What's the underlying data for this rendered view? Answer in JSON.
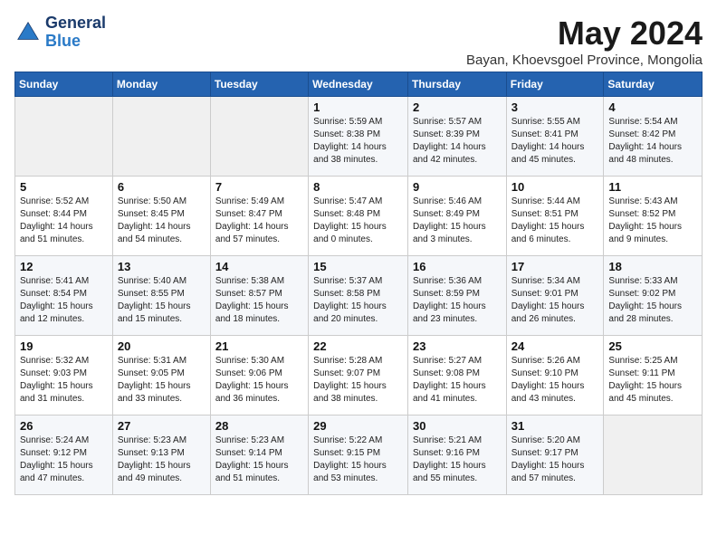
{
  "header": {
    "logo_general": "General",
    "logo_blue": "Blue",
    "month_title": "May 2024",
    "subtitle": "Bayan, Khoevsgoel Province, Mongolia"
  },
  "weekdays": [
    "Sunday",
    "Monday",
    "Tuesday",
    "Wednesday",
    "Thursday",
    "Friday",
    "Saturday"
  ],
  "weeks": [
    [
      {
        "day": "",
        "info": ""
      },
      {
        "day": "",
        "info": ""
      },
      {
        "day": "",
        "info": ""
      },
      {
        "day": "1",
        "info": "Sunrise: 5:59 AM\nSunset: 8:38 PM\nDaylight: 14 hours\nand 38 minutes."
      },
      {
        "day": "2",
        "info": "Sunrise: 5:57 AM\nSunset: 8:39 PM\nDaylight: 14 hours\nand 42 minutes."
      },
      {
        "day": "3",
        "info": "Sunrise: 5:55 AM\nSunset: 8:41 PM\nDaylight: 14 hours\nand 45 minutes."
      },
      {
        "day": "4",
        "info": "Sunrise: 5:54 AM\nSunset: 8:42 PM\nDaylight: 14 hours\nand 48 minutes."
      }
    ],
    [
      {
        "day": "5",
        "info": "Sunrise: 5:52 AM\nSunset: 8:44 PM\nDaylight: 14 hours\nand 51 minutes."
      },
      {
        "day": "6",
        "info": "Sunrise: 5:50 AM\nSunset: 8:45 PM\nDaylight: 14 hours\nand 54 minutes."
      },
      {
        "day": "7",
        "info": "Sunrise: 5:49 AM\nSunset: 8:47 PM\nDaylight: 14 hours\nand 57 minutes."
      },
      {
        "day": "8",
        "info": "Sunrise: 5:47 AM\nSunset: 8:48 PM\nDaylight: 15 hours\nand 0 minutes."
      },
      {
        "day": "9",
        "info": "Sunrise: 5:46 AM\nSunset: 8:49 PM\nDaylight: 15 hours\nand 3 minutes."
      },
      {
        "day": "10",
        "info": "Sunrise: 5:44 AM\nSunset: 8:51 PM\nDaylight: 15 hours\nand 6 minutes."
      },
      {
        "day": "11",
        "info": "Sunrise: 5:43 AM\nSunset: 8:52 PM\nDaylight: 15 hours\nand 9 minutes."
      }
    ],
    [
      {
        "day": "12",
        "info": "Sunrise: 5:41 AM\nSunset: 8:54 PM\nDaylight: 15 hours\nand 12 minutes."
      },
      {
        "day": "13",
        "info": "Sunrise: 5:40 AM\nSunset: 8:55 PM\nDaylight: 15 hours\nand 15 minutes."
      },
      {
        "day": "14",
        "info": "Sunrise: 5:38 AM\nSunset: 8:57 PM\nDaylight: 15 hours\nand 18 minutes."
      },
      {
        "day": "15",
        "info": "Sunrise: 5:37 AM\nSunset: 8:58 PM\nDaylight: 15 hours\nand 20 minutes."
      },
      {
        "day": "16",
        "info": "Sunrise: 5:36 AM\nSunset: 8:59 PM\nDaylight: 15 hours\nand 23 minutes."
      },
      {
        "day": "17",
        "info": "Sunrise: 5:34 AM\nSunset: 9:01 PM\nDaylight: 15 hours\nand 26 minutes."
      },
      {
        "day": "18",
        "info": "Sunrise: 5:33 AM\nSunset: 9:02 PM\nDaylight: 15 hours\nand 28 minutes."
      }
    ],
    [
      {
        "day": "19",
        "info": "Sunrise: 5:32 AM\nSunset: 9:03 PM\nDaylight: 15 hours\nand 31 minutes."
      },
      {
        "day": "20",
        "info": "Sunrise: 5:31 AM\nSunset: 9:05 PM\nDaylight: 15 hours\nand 33 minutes."
      },
      {
        "day": "21",
        "info": "Sunrise: 5:30 AM\nSunset: 9:06 PM\nDaylight: 15 hours\nand 36 minutes."
      },
      {
        "day": "22",
        "info": "Sunrise: 5:28 AM\nSunset: 9:07 PM\nDaylight: 15 hours\nand 38 minutes."
      },
      {
        "day": "23",
        "info": "Sunrise: 5:27 AM\nSunset: 9:08 PM\nDaylight: 15 hours\nand 41 minutes."
      },
      {
        "day": "24",
        "info": "Sunrise: 5:26 AM\nSunset: 9:10 PM\nDaylight: 15 hours\nand 43 minutes."
      },
      {
        "day": "25",
        "info": "Sunrise: 5:25 AM\nSunset: 9:11 PM\nDaylight: 15 hours\nand 45 minutes."
      }
    ],
    [
      {
        "day": "26",
        "info": "Sunrise: 5:24 AM\nSunset: 9:12 PM\nDaylight: 15 hours\nand 47 minutes."
      },
      {
        "day": "27",
        "info": "Sunrise: 5:23 AM\nSunset: 9:13 PM\nDaylight: 15 hours\nand 49 minutes."
      },
      {
        "day": "28",
        "info": "Sunrise: 5:23 AM\nSunset: 9:14 PM\nDaylight: 15 hours\nand 51 minutes."
      },
      {
        "day": "29",
        "info": "Sunrise: 5:22 AM\nSunset: 9:15 PM\nDaylight: 15 hours\nand 53 minutes."
      },
      {
        "day": "30",
        "info": "Sunrise: 5:21 AM\nSunset: 9:16 PM\nDaylight: 15 hours\nand 55 minutes."
      },
      {
        "day": "31",
        "info": "Sunrise: 5:20 AM\nSunset: 9:17 PM\nDaylight: 15 hours\nand 57 minutes."
      },
      {
        "day": "",
        "info": ""
      }
    ]
  ]
}
